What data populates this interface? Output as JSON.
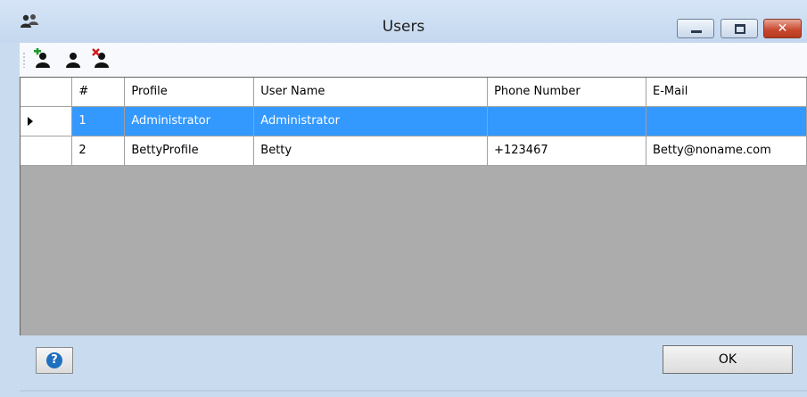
{
  "window": {
    "title": "Users",
    "app_icon": "users-icon",
    "controls": {
      "minimize": "minimize-icon",
      "maximize": "maximize-icon",
      "close_glyph": "✕"
    }
  },
  "toolbar": {
    "buttons": [
      {
        "icon": "add-user-icon"
      },
      {
        "icon": "edit-user-icon"
      },
      {
        "icon": "delete-user-icon"
      }
    ]
  },
  "grid": {
    "columns": [
      "#",
      "Profile",
      "User Name",
      "Phone Number",
      "E-Mail"
    ],
    "rows": [
      {
        "id": "1",
        "profile": "Administrator",
        "user_name": "Administrator",
        "phone": "",
        "email": "",
        "selected": true
      },
      {
        "id": "2",
        "profile": "BettyProfile",
        "user_name": "Betty",
        "phone": "+123467",
        "email": "Betty@noname.com",
        "selected": false
      }
    ]
  },
  "footer": {
    "help_glyph": "?",
    "ok_label": "OK"
  },
  "colors": {
    "selection": "#3399ff",
    "grid_background": "#acacac",
    "window_frame": "#c9dbee"
  }
}
